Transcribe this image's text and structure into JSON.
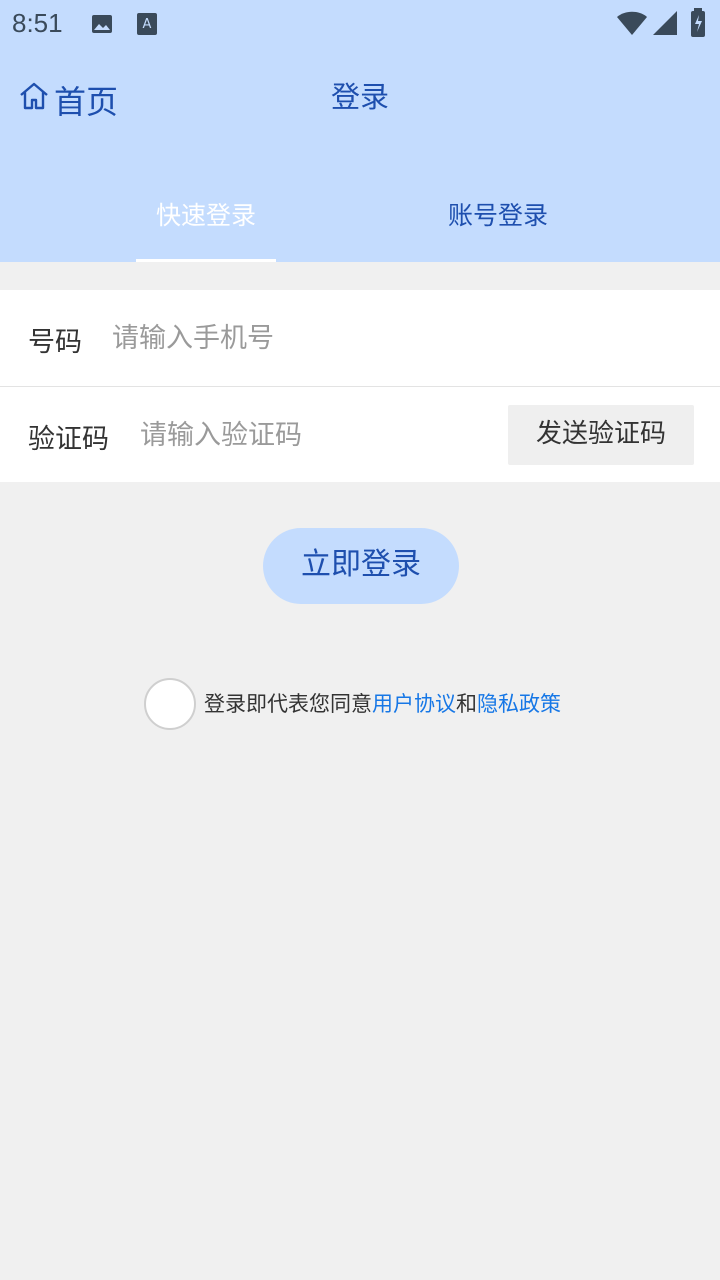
{
  "status_bar": {
    "time": "8:51",
    "icons": [
      "image-icon",
      "font-icon",
      "wifi-icon",
      "signal-icon",
      "battery-icon"
    ]
  },
  "header": {
    "home_label": "首页",
    "title": "登录",
    "tabs": [
      {
        "label": "快速登录",
        "active": true
      },
      {
        "label": "账号登录",
        "active": false
      }
    ]
  },
  "form": {
    "phone": {
      "label": "号码",
      "placeholder": "请输入手机号",
      "value": ""
    },
    "code": {
      "label": "验证码",
      "placeholder": "请输入验证码",
      "value": "",
      "send_label": "发送验证码"
    }
  },
  "login_button": "立即登录",
  "agreement": {
    "prefix": "登录即代表您同意",
    "user_agreement": "用户协议",
    "conjunction": "和",
    "privacy_policy": "隐私政策",
    "checked": false
  },
  "colors": {
    "header_bg": "#c4dcfe",
    "primary_text": "#1e4fae",
    "link": "#1677e6",
    "page_bg": "#f0f0f0"
  }
}
